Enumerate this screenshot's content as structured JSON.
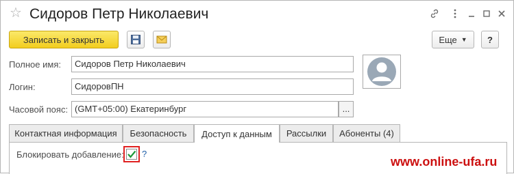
{
  "window": {
    "title": "Сидоров Петр Николаевич",
    "controls": [
      "link-icon",
      "more-icon",
      "minimize-icon",
      "maximize-icon",
      "close-icon"
    ]
  },
  "toolbar": {
    "save_close_label": "Записать и закрыть",
    "more_label": "Еще",
    "help_label": "?"
  },
  "form": {
    "full_name_label": "Полное имя:",
    "full_name_value": "Сидоров Петр Николаевич",
    "login_label": "Логин:",
    "login_value": "СидоровПН",
    "timezone_label": "Часовой пояс:",
    "timezone_value": "(GMT+05:00) Екатеринбург",
    "timezone_select_label": "..."
  },
  "tabs": [
    {
      "label": "Контактная информация",
      "active": false
    },
    {
      "label": "Безопасность",
      "active": false
    },
    {
      "label": "Доступ к данным",
      "active": true
    },
    {
      "label": "Рассылки",
      "active": false
    },
    {
      "label": "Абоненты (4)",
      "active": false
    }
  ],
  "access": {
    "block_adding_label": "Блокировать добавление:",
    "block_adding_checked": true,
    "help_label": "?"
  },
  "watermark": "www.online-ufa.ru",
  "colors": {
    "primary_button": "#f2cd1e",
    "highlight_border": "#e02020",
    "check_mark": "#1e9a3a",
    "watermark": "#cc1010"
  }
}
